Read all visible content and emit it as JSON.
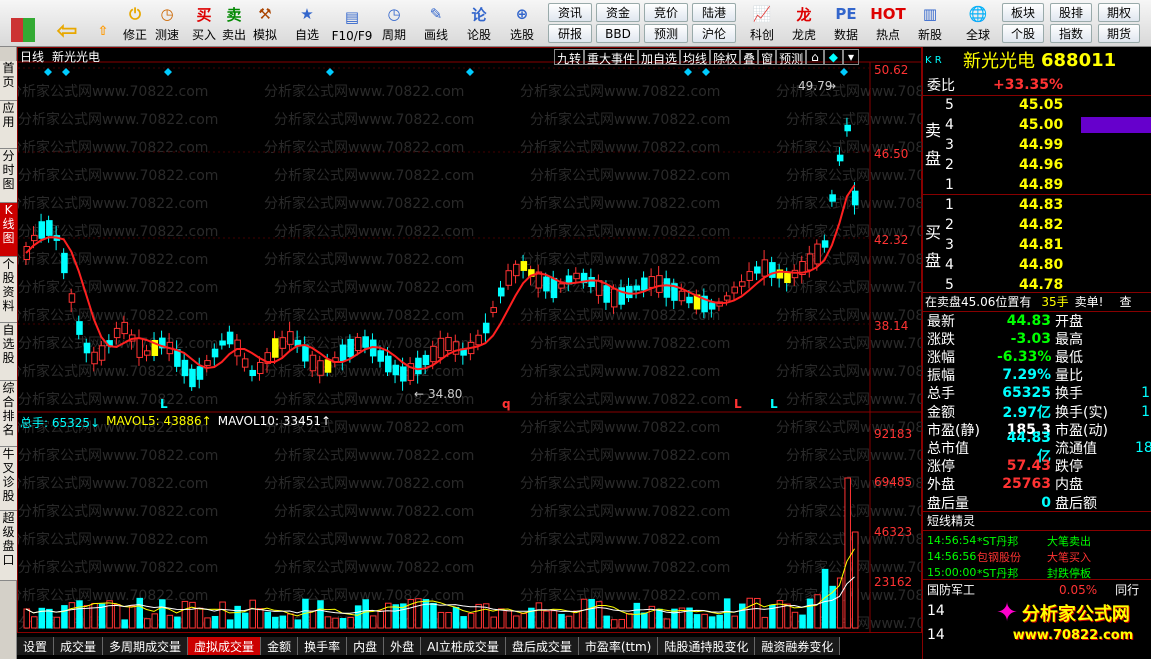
{
  "toolbar": {
    "buttons": [
      "修正",
      "测速",
      "买入",
      "卖出",
      "模拟",
      "自选",
      "F10/F9",
      "周期",
      "画线",
      "论股",
      "选股",
      "全球",
      "个股",
      "指数"
    ],
    "grid_top": [
      "资讯",
      "资金",
      "竞价",
      "陆港",
      "板块",
      "期权"
    ],
    "grid_bottom": [
      "研报",
      "BBD",
      "预测",
      "沪伦",
      "股排",
      "期货"
    ],
    "icons": [
      "科创",
      "龙虎",
      "数据",
      "热点",
      "新股"
    ]
  },
  "left_tabs": [
    "首页",
    "应用",
    "分时图",
    "K线图",
    "个股资料",
    "自选股",
    "综合排名",
    "牛叉诊股",
    "超级盘口"
  ],
  "chart": {
    "period": "日线",
    "stock_name": "新光光电",
    "top_buttons": [
      "九转",
      "重大事件",
      "加自选",
      "均线",
      "除权",
      "叠",
      "窗",
      "预测"
    ],
    "price_axis": [
      "50.62",
      "46.50",
      "42.32",
      "38.14"
    ],
    "high_label": "49.79",
    "low_label": "34.80",
    "markers": [
      "L",
      "q",
      "L",
      "L"
    ],
    "volume_header": {
      "vol": "总手: 65325↓",
      "mavol5": "MAVOL5: 43886↑",
      "mavol10": "MAVOL10: 33451↑"
    },
    "volume_axis": [
      "92183",
      "69485",
      "46323",
      "23162"
    ],
    "watermark": "分析家公式网www.70822.com"
  },
  "bottom_tabs": [
    "设置",
    "成交量",
    "多周期成交量",
    "虚拟成交量",
    "金额",
    "换手率",
    "内盘",
    "外盘",
    "AI立桩成交量",
    "盘后成交量",
    "市盈率(ttm)",
    "陆股通持股变化",
    "融资融券变化"
  ],
  "panel": {
    "code_label": "K R",
    "title": "新光光电",
    "code": "688011",
    "weibi_label": "委比",
    "weibi": "+33.35%",
    "sell_label": "卖盘",
    "buy_label": "买盘",
    "sells": [
      {
        "lvl": "5",
        "price": "45.05"
      },
      {
        "lvl": "4",
        "price": "45.00"
      },
      {
        "lvl": "3",
        "price": "44.99"
      },
      {
        "lvl": "2",
        "price": "44.96"
      },
      {
        "lvl": "1",
        "price": "44.89"
      }
    ],
    "buys": [
      {
        "lvl": "1",
        "price": "44.83"
      },
      {
        "lvl": "2",
        "price": "44.82"
      },
      {
        "lvl": "3",
        "price": "44.81"
      },
      {
        "lvl": "4",
        "price": "44.80"
      },
      {
        "lvl": "5",
        "price": "44.78"
      }
    ],
    "notice": "在卖盘45.06位置有",
    "notice_vol": "35手",
    "notice_tag": "卖单!",
    "notice_extra": "查",
    "stats": [
      {
        "k": "最新",
        "v": "44.83",
        "c": "grn",
        "k2": "开盘",
        "v2": ""
      },
      {
        "k": "涨跌",
        "v": "-3.03",
        "c": "grn",
        "k2": "最高",
        "v2": ""
      },
      {
        "k": "涨幅",
        "v": "-6.33%",
        "c": "grn",
        "k2": "最低",
        "v2": ""
      },
      {
        "k": "振幅",
        "v": "7.29%",
        "c": "cyan",
        "k2": "量比",
        "v2": ""
      },
      {
        "k": "总手",
        "v": "65325",
        "c": "cyan",
        "k2": "换手",
        "v2": "1"
      },
      {
        "k": "金额",
        "v": "2.97亿",
        "c": "cyan",
        "k2": "换手(实)",
        "v2": "1"
      },
      {
        "k": "市盈(静)",
        "v": "185.3",
        "c": "lbl",
        "k2": "市盈(动)",
        "v2": ""
      },
      {
        "k": "总市值",
        "v": "44.83亿",
        "c": "cyan",
        "k2": "流通值",
        "v2": "18"
      },
      {
        "k": "涨停",
        "v": "57.43",
        "c": "red",
        "k2": "跌停",
        "v2": ""
      },
      {
        "k": "外盘",
        "v": "25763",
        "c": "red",
        "k2": "内盘",
        "v2": ""
      },
      {
        "k": "盘后量",
        "v": "0",
        "c": "cyan",
        "k2": "盘后额",
        "v2": ""
      }
    ],
    "sprite_title": "短线精灵",
    "sprites": [
      {
        "t": "14:56:54",
        "n": "*ST丹邦",
        "e": "大笔卖出"
      },
      {
        "t": "14:56:56",
        "n": "包钢股份",
        "e": "大笔买入"
      },
      {
        "t": "15:00:00",
        "n": "*ST丹邦",
        "e": "封跌停板"
      }
    ],
    "industry": "国防军工",
    "industry_pct": "0.05%",
    "industry_extra": "同行",
    "bottom_nums": [
      "14",
      "14"
    ],
    "logo_text": "分析家公式网",
    "logo_url": "www.70822.com"
  },
  "colors": {
    "up": "#ff3333",
    "down": "#00ffff",
    "ma_up": "#ff0000",
    "ma_down": "#00ff00",
    "accent": "#ffff00"
  }
}
